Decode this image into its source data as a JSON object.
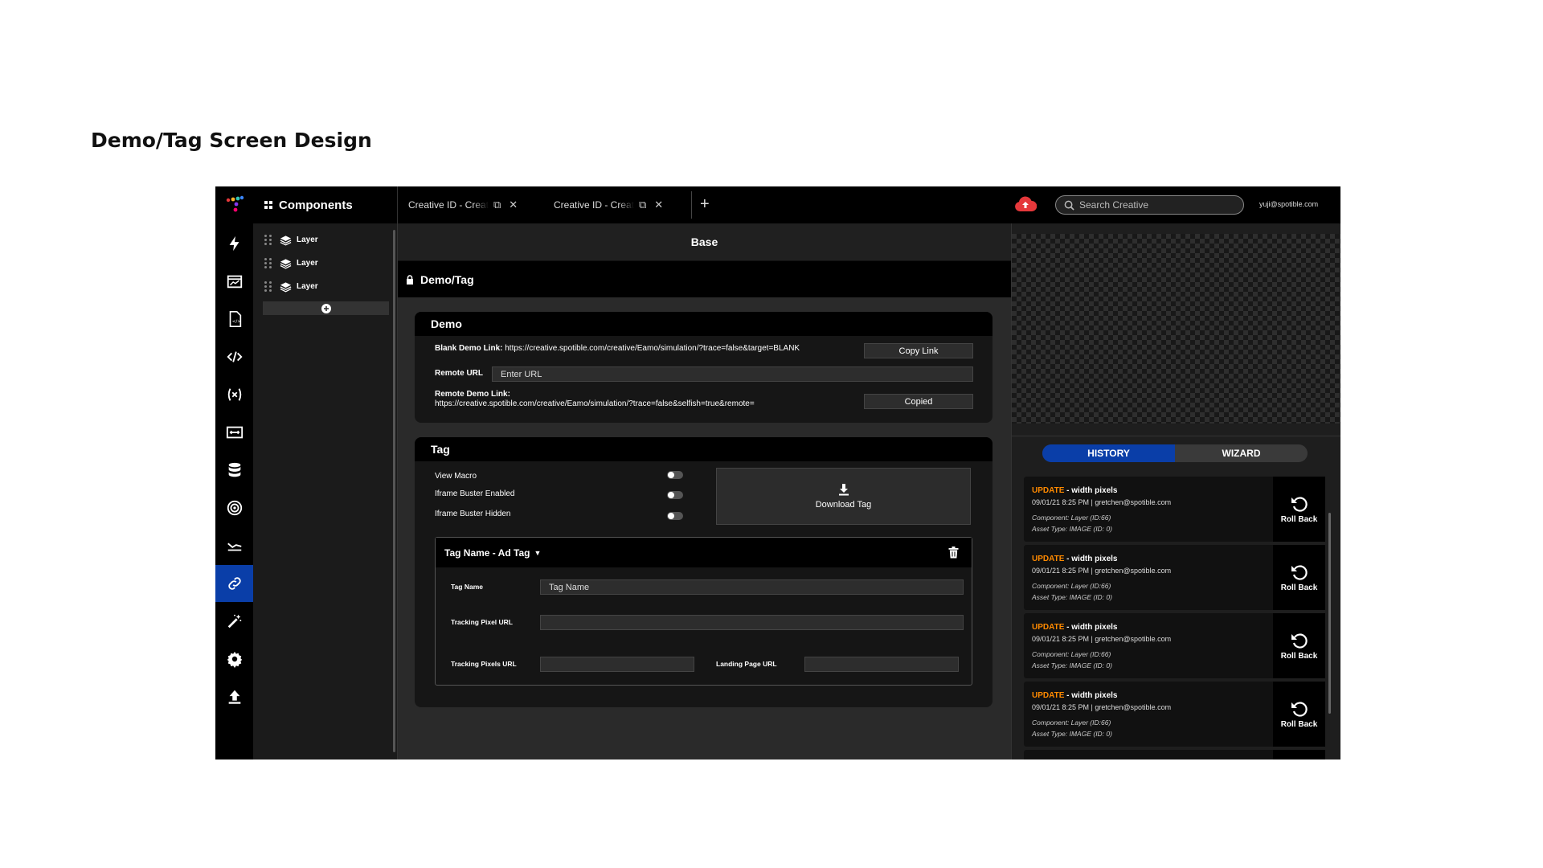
{
  "page_title": "Demo/Tag Screen Design",
  "components": {
    "title": "Components",
    "layers": [
      "Layer",
      "Layer",
      "Layer"
    ]
  },
  "tabs": [
    {
      "label": "Creative ID - Creative Name"
    },
    {
      "label": "Creative ID - Creative Name"
    }
  ],
  "search": {
    "placeholder": "Search Creative"
  },
  "user_email": "yuji@spotible.com",
  "center": {
    "base_title": "Base",
    "section_title": "Demo/Tag",
    "demo": {
      "title": "Demo",
      "blank_label": "Blank Demo Link:",
      "blank_url": "https://creative.spotible.com/creative/Eamo/simulation/?trace=false&target=BLANK",
      "copy_link": "Copy Link",
      "remote_url_label": "Remote URL",
      "remote_url_placeholder": "Enter URL",
      "remote_demo_label": "Remote Demo Link:",
      "remote_demo_url": "https://creative.spotible.com/creative/Eamo/simulation/?trace=false&selfish=true&remote=",
      "copied": "Copied"
    },
    "tag": {
      "title": "Tag",
      "view_macro": "View Macro",
      "iframe_buster_enabled": "Iframe Buster Enabled",
      "iframe_buster_hidden": "Iframe Buster Hidden",
      "download_tag": "Download Tag",
      "tag_name_header": "Tag Name - Ad Tag",
      "tag_name_label": "Tag Name",
      "tag_name_value": "Tag Name",
      "tracking_pixel_label": "Tracking Pixel URL",
      "tracking_pixels_label": "Tracking Pixels URL",
      "landing_page_label": "Landing Page URL"
    }
  },
  "history": {
    "tabs": [
      "HISTORY",
      "WIZARD"
    ],
    "items": [
      {
        "action": "UPDATE",
        "desc": " - width pixels",
        "meta": "09/01/21 8:25 PM | gretchen@spotible.com",
        "component": "Component: Layer (ID:66)",
        "asset": "Asset Type: IMAGE (ID: 0)",
        "button": "Roll Back"
      },
      {
        "action": "UPDATE",
        "desc": " - width pixels",
        "meta": "09/01/21 8:25 PM | gretchen@spotible.com",
        "component": "Component: Layer (ID:66)",
        "asset": "Asset Type: IMAGE (ID: 0)",
        "button": "Roll Back"
      },
      {
        "action": "UPDATE",
        "desc": " - width pixels",
        "meta": "09/01/21 8:25 PM | gretchen@spotible.com",
        "component": "Component: Layer (ID:66)",
        "asset": "Asset Type: IMAGE (ID: 0)",
        "button": "Roll Back"
      },
      {
        "action": "UPDATE",
        "desc": " - width pixels",
        "meta": "09/01/21 8:25 PM | gretchen@spotible.com",
        "component": "Component: Layer (ID:66)",
        "asset": "Asset Type: IMAGE (ID: 0)",
        "button": "Roll Back"
      }
    ]
  },
  "colors": {
    "accent": "#0a3ea8",
    "update": "#ff8a00",
    "cloud": "#e5383b"
  }
}
